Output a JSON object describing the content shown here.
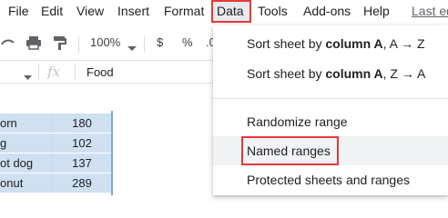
{
  "menubar": {
    "items": [
      "File",
      "Edit",
      "View",
      "Insert",
      "Format",
      "Data",
      "Tools",
      "Add-ons",
      "Help"
    ],
    "last_edit": "Last ed"
  },
  "toolbar": {
    "zoom": "100%",
    "currency": "$",
    "percent": "%",
    "decimal": ".0"
  },
  "formulabar": {
    "fx": "fx",
    "value": "Food"
  },
  "grid": {
    "rows": [
      {
        "a": "orn",
        "b": "180"
      },
      {
        "a": "g",
        "b": "102"
      },
      {
        "a": "ot dog",
        "b": "137"
      },
      {
        "a": "onut",
        "b": "289"
      }
    ]
  },
  "dropdown": {
    "sort_az_prefix": "Sort sheet by ",
    "sort_az_bold": "column A",
    "sort_az_suffix": ", A → Z",
    "sort_za_prefix": "Sort sheet by ",
    "sort_za_bold": "column A",
    "sort_za_suffix": ", Z → A",
    "randomize": "Randomize range",
    "named_ranges": "Named ranges",
    "protected": "Protected sheets and ranges"
  },
  "colors": {
    "highlight_border": "#e53935",
    "selection_fill": "#cfe0f1"
  }
}
